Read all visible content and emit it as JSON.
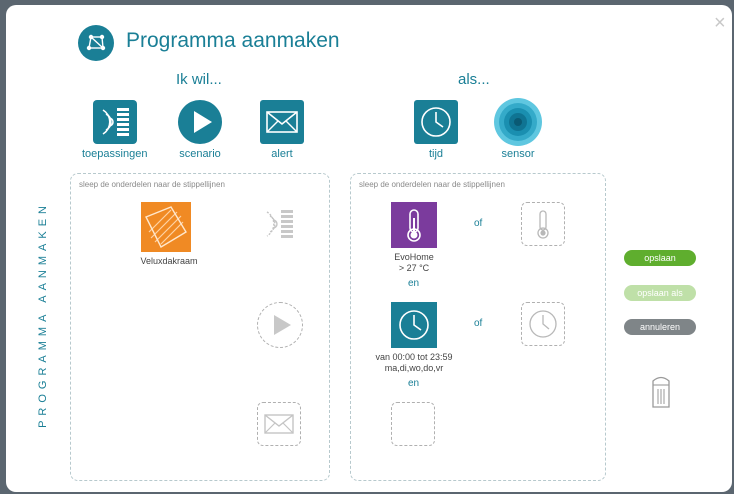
{
  "dialog": {
    "title": "Programma aanmaken",
    "title_icon": "network-icon",
    "close_label": "×",
    "vertical_title": "PROGRAMMA AANMAKEN"
  },
  "toolbox": {
    "ik_wil": "Ik wil...",
    "als": "als...",
    "items": [
      {
        "label": "toepassingen",
        "icon": "devices-icon"
      },
      {
        "label": "scenario",
        "icon": "play-icon"
      },
      {
        "label": "alert",
        "icon": "envelope-icon"
      },
      {
        "label": "tijd",
        "icon": "clock-icon"
      },
      {
        "label": "sensor",
        "icon": "sensor-icon"
      }
    ]
  },
  "actions_panel": {
    "hint": "sleep de onderdelen naar de stippellijnen",
    "device_label": "Veluxdakraam"
  },
  "conditions_panel": {
    "hint": "sleep de onderdelen naar de stippellijnen",
    "rows": [
      {
        "label": "EvoHome",
        "detail": "> 27 °C",
        "conj_right": "of",
        "conj_below": "en"
      },
      {
        "label": "van 00:00 tot 23:59",
        "detail": "ma,di,wo,do,vr",
        "conj_right": "of",
        "conj_below": "en"
      }
    ]
  },
  "buttons": {
    "save": "opslaan",
    "save_as": "opslaan als",
    "cancel": "annuleren"
  },
  "colors": {
    "accent": "#1a7f96",
    "purple": "#7b3b9d",
    "orange": "#f08a24",
    "save": "#5fae2e",
    "save_as": "#bfe0a8",
    "cancel": "#7f8588"
  }
}
